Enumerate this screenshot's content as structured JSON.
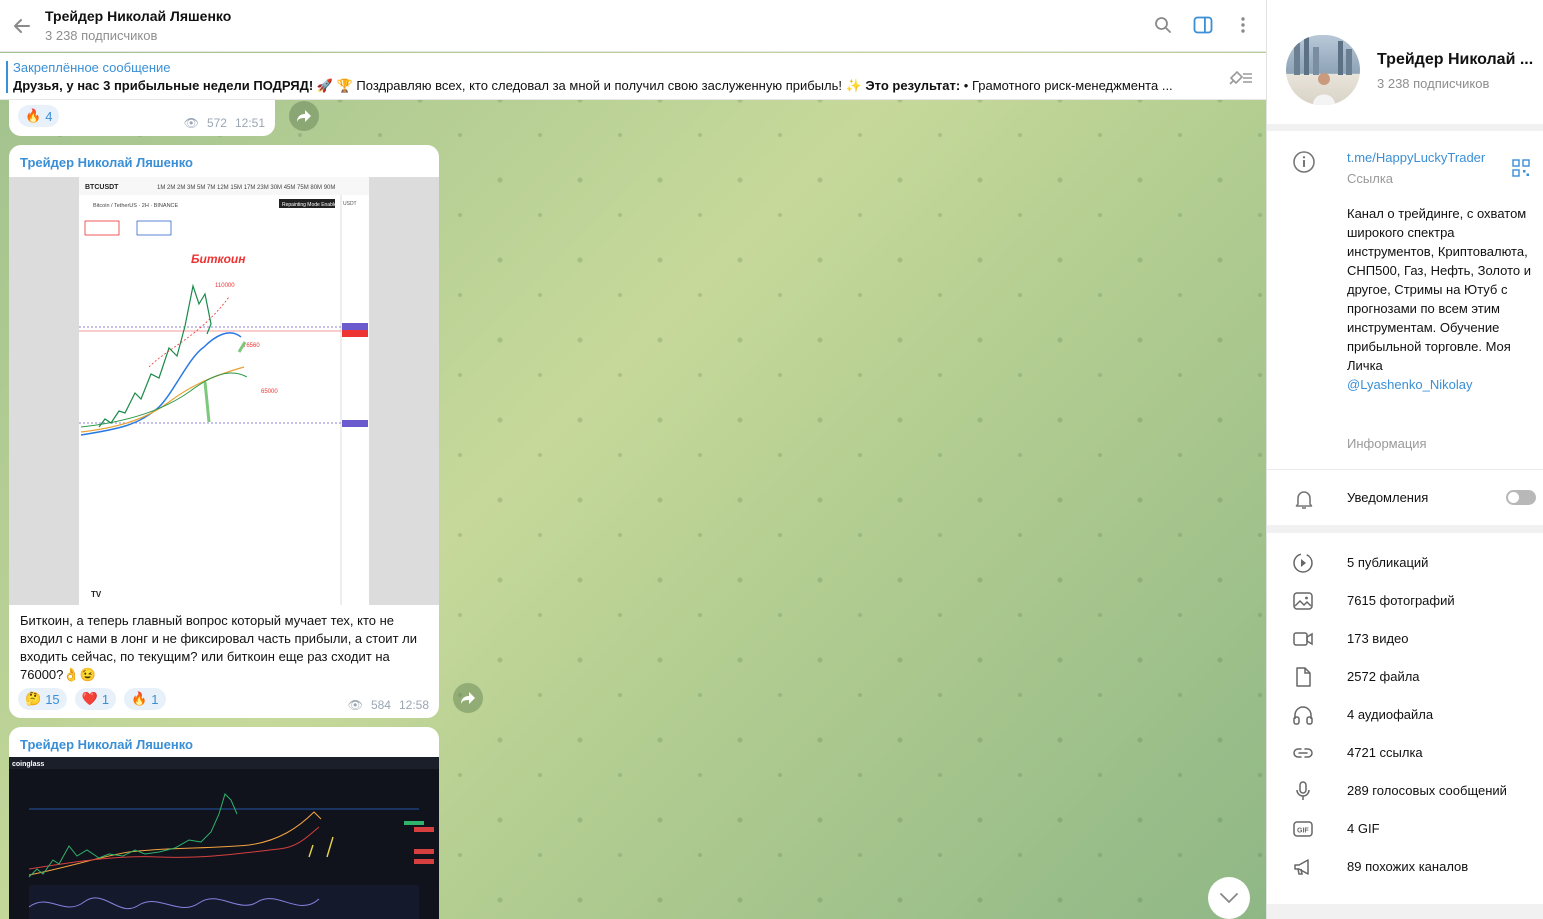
{
  "topbar": {
    "title": "Трейдер Николай Ляшенко",
    "subtitle": "3 238 подписчиков"
  },
  "pinned": {
    "title": "Закреплённое сообщение",
    "text_bold": "Друзья, у нас 3 прибыльные недели ПОДРЯД! 🚀 🏆",
    "text_normal": " Поздравляю всех, кто следовал за мной и получил свою заслуженную прибыль! ✨ ",
    "text_bold2": "Это результат:",
    "text_tail": " • Грамотного риск-менеджмента ..."
  },
  "messages": [
    {
      "reactions": [
        {
          "emoji": "🔥",
          "count": "4"
        }
      ],
      "views": "572",
      "time": "12:51"
    },
    {
      "sender": "Трейдер Николай Ляшенко",
      "image_title": "Биткоин",
      "text": "Биткоин, а теперь главный вопрос  который мучает тех, кто не входил с нами в лонг и не фиксировал часть прибыли, а стоит ли входить сейчас, по текущим? или биткоин еще раз сходит на 76000?👌😉",
      "reactions": [
        {
          "emoji": "🤔",
          "count": "15"
        },
        {
          "emoji": "❤️",
          "count": "1"
        },
        {
          "emoji": "🔥",
          "count": "1"
        }
      ],
      "views": "584",
      "time": "12:58"
    },
    {
      "sender": "Трейдер Николай Ляшенко"
    }
  ],
  "chart_labels": {
    "symbol": "BTCUSDT",
    "pair": "Bitcoin / TetherUS · 2H · BINANCE",
    "timeframes": [
      "1M",
      "2M",
      "2M",
      "3M",
      "5M",
      "7M",
      "12M",
      "15M",
      "17M",
      "23M",
      "30M",
      "45M",
      "75M",
      "80M",
      "90M"
    ],
    "level_top": "110000",
    "level_mid": "76560",
    "level_low": "65000",
    "brand": "coinglass"
  },
  "panel": {
    "name": "Трейдер Николай ...",
    "subtitle": "3 238 подписчиков",
    "link": "t.me/HappyLuckyTrader",
    "link_label": "Ссылка",
    "description": "Канал о трейдинге, с охватом широкого спектра инструментов, Криптовалюта, СНП500, Газ, Нефть, Золото и другое, Стримы на Ютуб с прогнозами по всем этим инструментам. Обучение прибыльной торговле. Моя Личка",
    "desc_link": "@Lyashenko_Nikolay",
    "desc_label": "Информация",
    "notifications": "Уведомления",
    "stats": [
      {
        "icon": "publications-icon",
        "label": "5 публикаций"
      },
      {
        "icon": "photo-icon",
        "label": "7615 фотографий"
      },
      {
        "icon": "video-icon",
        "label": "173 видео"
      },
      {
        "icon": "file-icon",
        "label": "2572 файла"
      },
      {
        "icon": "headphones-icon",
        "label": "4 аудиофайла"
      },
      {
        "icon": "link-icon",
        "label": "4721 ссылка"
      },
      {
        "icon": "microphone-icon",
        "label": "289 голосовых сообщений"
      },
      {
        "icon": "gif-icon",
        "label": "4 GIF"
      },
      {
        "icon": "megaphone-icon",
        "label": "89 похожих каналов"
      }
    ]
  }
}
